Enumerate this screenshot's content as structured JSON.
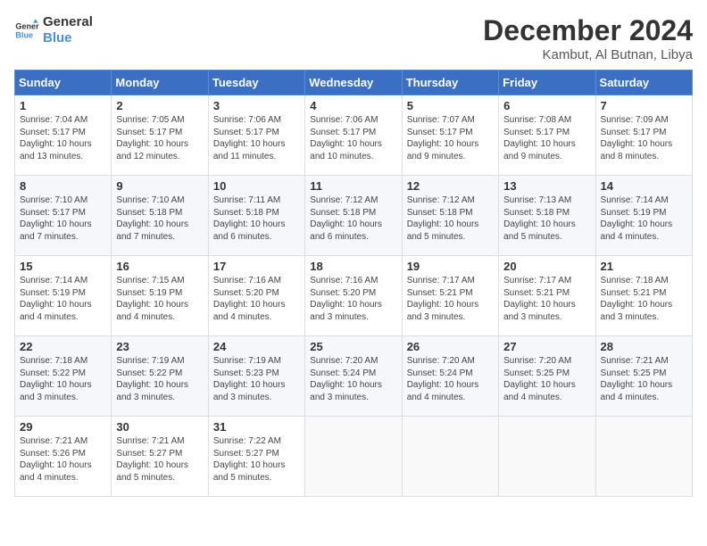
{
  "logo": {
    "line1": "General",
    "line2": "Blue"
  },
  "title": "December 2024",
  "location": "Kambut, Al Butnan, Libya",
  "days_of_week": [
    "Sunday",
    "Monday",
    "Tuesday",
    "Wednesday",
    "Thursday",
    "Friday",
    "Saturday"
  ],
  "weeks": [
    [
      {
        "day": "1",
        "info": "Sunrise: 7:04 AM\nSunset: 5:17 PM\nDaylight: 10 hours\nand 13 minutes."
      },
      {
        "day": "2",
        "info": "Sunrise: 7:05 AM\nSunset: 5:17 PM\nDaylight: 10 hours\nand 12 minutes."
      },
      {
        "day": "3",
        "info": "Sunrise: 7:06 AM\nSunset: 5:17 PM\nDaylight: 10 hours\nand 11 minutes."
      },
      {
        "day": "4",
        "info": "Sunrise: 7:06 AM\nSunset: 5:17 PM\nDaylight: 10 hours\nand 10 minutes."
      },
      {
        "day": "5",
        "info": "Sunrise: 7:07 AM\nSunset: 5:17 PM\nDaylight: 10 hours\nand 9 minutes."
      },
      {
        "day": "6",
        "info": "Sunrise: 7:08 AM\nSunset: 5:17 PM\nDaylight: 10 hours\nand 9 minutes."
      },
      {
        "day": "7",
        "info": "Sunrise: 7:09 AM\nSunset: 5:17 PM\nDaylight: 10 hours\nand 8 minutes."
      }
    ],
    [
      {
        "day": "8",
        "info": "Sunrise: 7:10 AM\nSunset: 5:17 PM\nDaylight: 10 hours\nand 7 minutes."
      },
      {
        "day": "9",
        "info": "Sunrise: 7:10 AM\nSunset: 5:18 PM\nDaylight: 10 hours\nand 7 minutes."
      },
      {
        "day": "10",
        "info": "Sunrise: 7:11 AM\nSunset: 5:18 PM\nDaylight: 10 hours\nand 6 minutes."
      },
      {
        "day": "11",
        "info": "Sunrise: 7:12 AM\nSunset: 5:18 PM\nDaylight: 10 hours\nand 6 minutes."
      },
      {
        "day": "12",
        "info": "Sunrise: 7:12 AM\nSunset: 5:18 PM\nDaylight: 10 hours\nand 5 minutes."
      },
      {
        "day": "13",
        "info": "Sunrise: 7:13 AM\nSunset: 5:18 PM\nDaylight: 10 hours\nand 5 minutes."
      },
      {
        "day": "14",
        "info": "Sunrise: 7:14 AM\nSunset: 5:19 PM\nDaylight: 10 hours\nand 4 minutes."
      }
    ],
    [
      {
        "day": "15",
        "info": "Sunrise: 7:14 AM\nSunset: 5:19 PM\nDaylight: 10 hours\nand 4 minutes."
      },
      {
        "day": "16",
        "info": "Sunrise: 7:15 AM\nSunset: 5:19 PM\nDaylight: 10 hours\nand 4 minutes."
      },
      {
        "day": "17",
        "info": "Sunrise: 7:16 AM\nSunset: 5:20 PM\nDaylight: 10 hours\nand 4 minutes."
      },
      {
        "day": "18",
        "info": "Sunrise: 7:16 AM\nSunset: 5:20 PM\nDaylight: 10 hours\nand 3 minutes."
      },
      {
        "day": "19",
        "info": "Sunrise: 7:17 AM\nSunset: 5:21 PM\nDaylight: 10 hours\nand 3 minutes."
      },
      {
        "day": "20",
        "info": "Sunrise: 7:17 AM\nSunset: 5:21 PM\nDaylight: 10 hours\nand 3 minutes."
      },
      {
        "day": "21",
        "info": "Sunrise: 7:18 AM\nSunset: 5:21 PM\nDaylight: 10 hours\nand 3 minutes."
      }
    ],
    [
      {
        "day": "22",
        "info": "Sunrise: 7:18 AM\nSunset: 5:22 PM\nDaylight: 10 hours\nand 3 minutes."
      },
      {
        "day": "23",
        "info": "Sunrise: 7:19 AM\nSunset: 5:22 PM\nDaylight: 10 hours\nand 3 minutes."
      },
      {
        "day": "24",
        "info": "Sunrise: 7:19 AM\nSunset: 5:23 PM\nDaylight: 10 hours\nand 3 minutes."
      },
      {
        "day": "25",
        "info": "Sunrise: 7:20 AM\nSunset: 5:24 PM\nDaylight: 10 hours\nand 3 minutes."
      },
      {
        "day": "26",
        "info": "Sunrise: 7:20 AM\nSunset: 5:24 PM\nDaylight: 10 hours\nand 4 minutes."
      },
      {
        "day": "27",
        "info": "Sunrise: 7:20 AM\nSunset: 5:25 PM\nDaylight: 10 hours\nand 4 minutes."
      },
      {
        "day": "28",
        "info": "Sunrise: 7:21 AM\nSunset: 5:25 PM\nDaylight: 10 hours\nand 4 minutes."
      }
    ],
    [
      {
        "day": "29",
        "info": "Sunrise: 7:21 AM\nSunset: 5:26 PM\nDaylight: 10 hours\nand 4 minutes."
      },
      {
        "day": "30",
        "info": "Sunrise: 7:21 AM\nSunset: 5:27 PM\nDaylight: 10 hours\nand 5 minutes."
      },
      {
        "day": "31",
        "info": "Sunrise: 7:22 AM\nSunset: 5:27 PM\nDaylight: 10 hours\nand 5 minutes."
      },
      null,
      null,
      null,
      null
    ]
  ]
}
